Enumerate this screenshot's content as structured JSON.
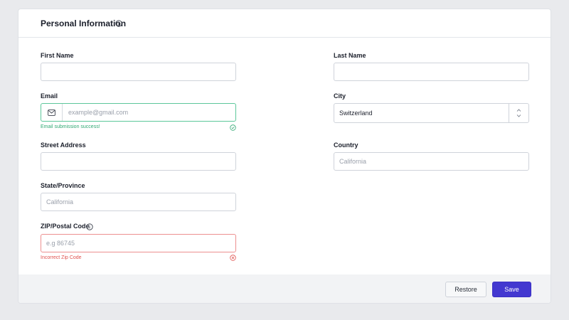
{
  "header": {
    "title": "Personal Information",
    "info_icon": "info-icon"
  },
  "fields": {
    "first_name": {
      "label": "First Name",
      "value": ""
    },
    "last_name": {
      "label": "Last Name",
      "value": ""
    },
    "email": {
      "label": "Email",
      "placeholder": "example@gmail.com",
      "icon": "mail-icon",
      "helper": "Email submission success!",
      "status": "success"
    },
    "city": {
      "label": "City",
      "value": "Switzerland"
    },
    "street": {
      "label": "Street Address",
      "value": ""
    },
    "country": {
      "label": "Country",
      "placeholder": "California"
    },
    "state": {
      "label": "State/Province",
      "placeholder": "California"
    },
    "zip": {
      "label": "ZIP/Postal Code",
      "placeholder": "e.g 86745",
      "helper": "Incorrect Zip Code",
      "status": "error"
    }
  },
  "footer": {
    "restore_label": "Restore",
    "save_label": "Save"
  },
  "colors": {
    "accent": "#4338d0",
    "success": "#2fa872",
    "error": "#e0524f",
    "success_border": "#5cc79a",
    "error_border": "#ec8f8f"
  }
}
